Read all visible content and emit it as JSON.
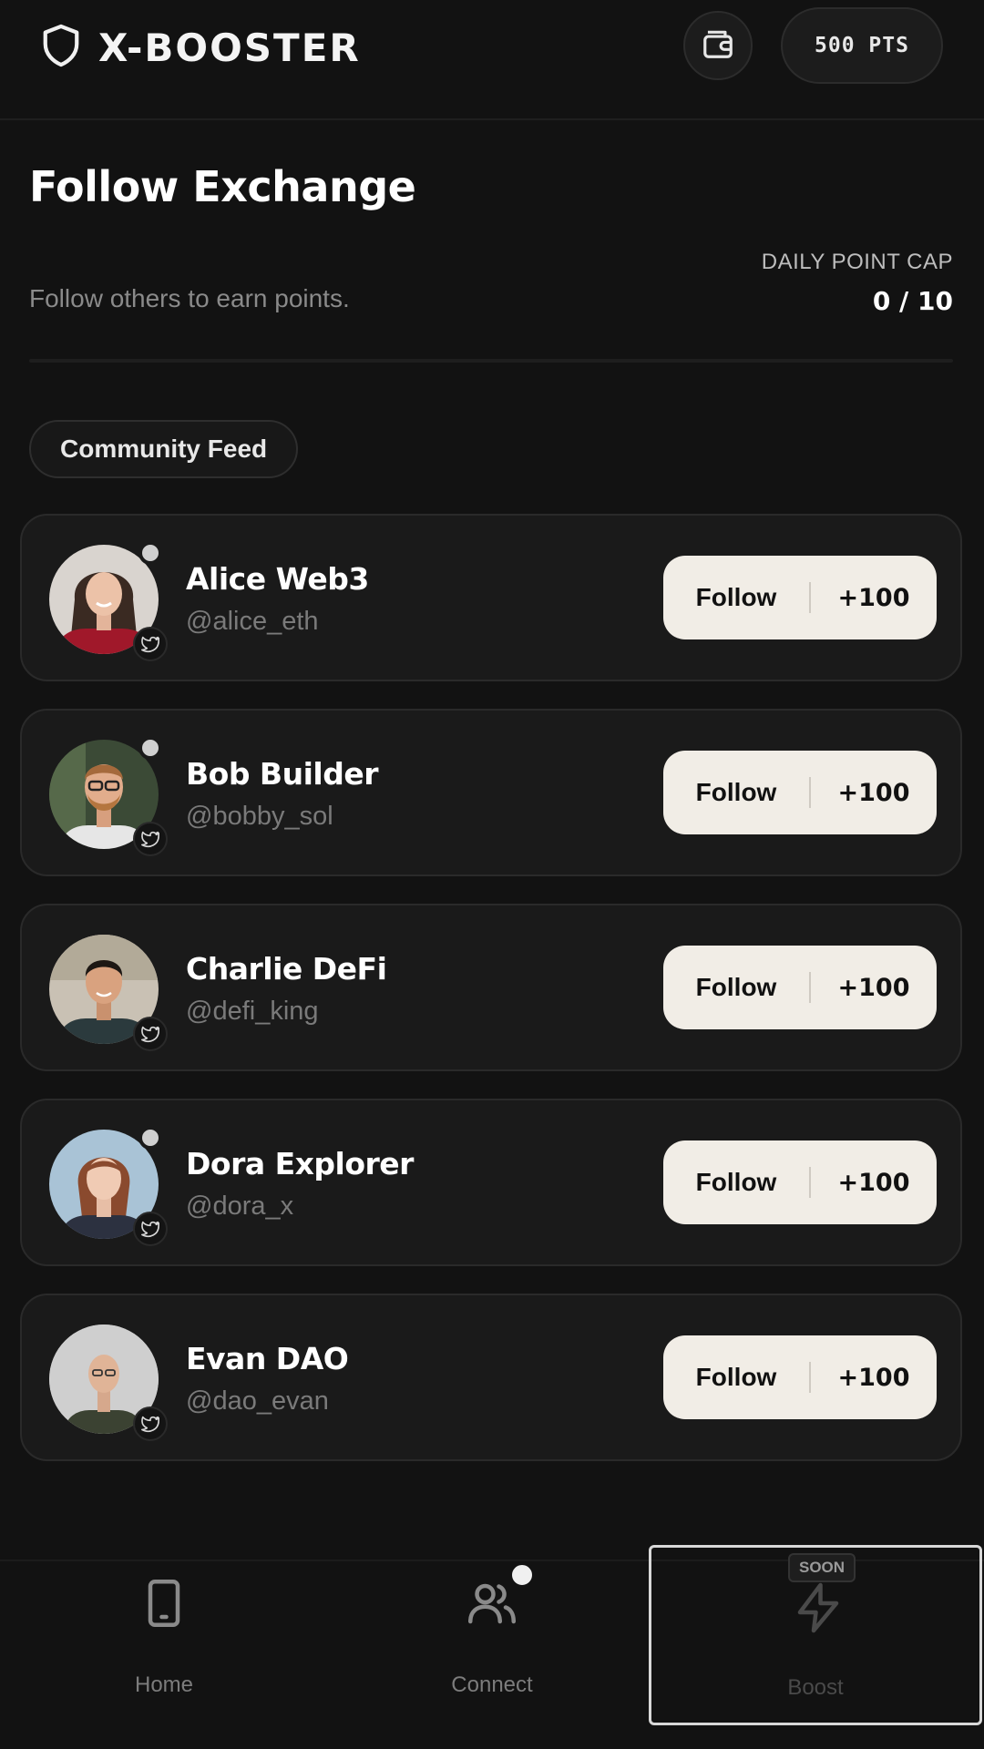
{
  "header": {
    "brand": "X-BOOSTER",
    "points_badge": "500 PTS",
    "icons": {
      "brand": "shield-icon",
      "wallet": "wallet-icon"
    }
  },
  "page": {
    "title": "Follow Exchange",
    "subtitle": "Follow others to earn points.",
    "daily_cap_label": "DAILY POINT CAP",
    "daily_cap_value": "0 / 10",
    "feed_chip": "Community Feed"
  },
  "users": [
    {
      "name": "Alice Web3",
      "handle": "@alice_eth",
      "follow_label": "Follow",
      "reward": "+100"
    },
    {
      "name": "Bob Builder",
      "handle": "@bobby_sol",
      "follow_label": "Follow",
      "reward": "+100"
    },
    {
      "name": "Charlie DeFi",
      "handle": "@defi_king",
      "follow_label": "Follow",
      "reward": "+100"
    },
    {
      "name": "Dora Explorer",
      "handle": "@dora_x",
      "follow_label": "Follow",
      "reward": "+100"
    },
    {
      "name": "Evan DAO",
      "handle": "@dao_evan",
      "follow_label": "Follow",
      "reward": "+100"
    }
  ],
  "nav": {
    "home": {
      "label": "Home",
      "icon": "tablet-icon"
    },
    "connect": {
      "label": "Connect",
      "icon": "users-icon"
    },
    "boost": {
      "label": "Boost",
      "icon": "lightning-icon",
      "badge": "SOON"
    }
  },
  "colors": {
    "background": "#121212",
    "card": "#1a1a1a",
    "button": "#f1ede6",
    "muted_text": "#7a7a7a"
  }
}
